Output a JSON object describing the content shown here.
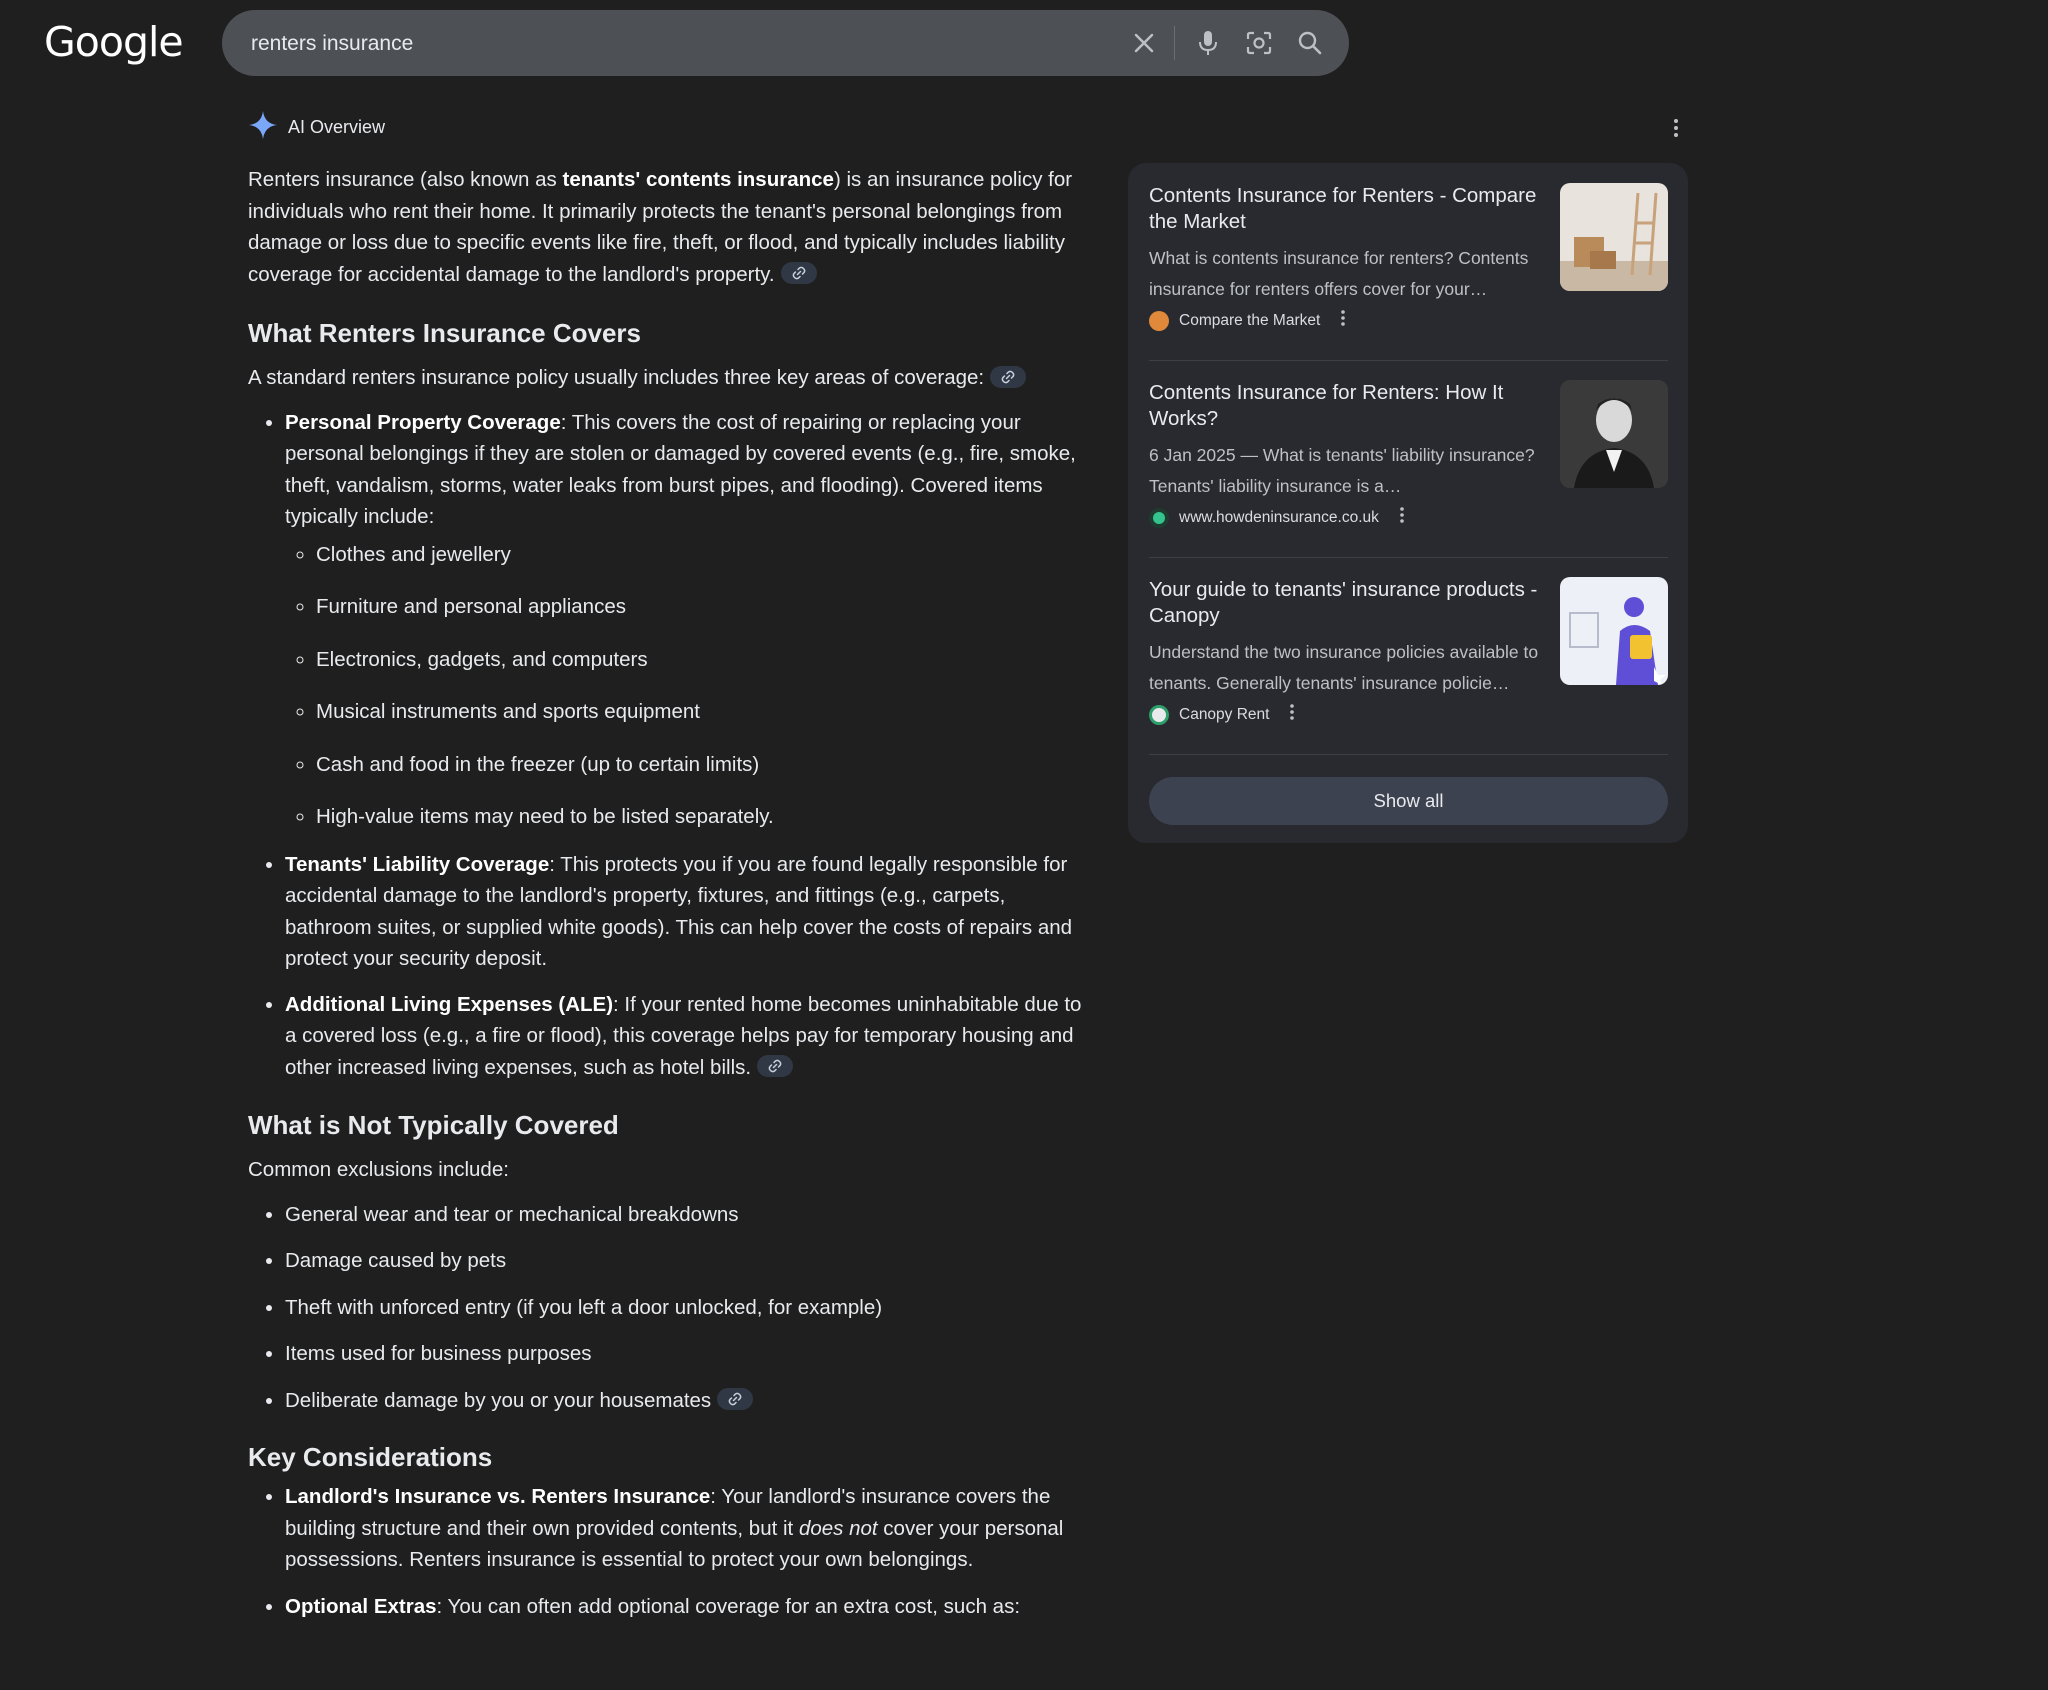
{
  "header": {
    "logo": "Google",
    "search_value": "renters insurance"
  },
  "ai_overview": {
    "label": "AI Overview",
    "intro": {
      "pre": "Renters insurance (also known as ",
      "bold": "tenants' contents insurance",
      "post": ") is an insurance policy for individuals who rent their home. It primarily protects the tenant's personal belongings from damage or loss due to specific events like fire, theft, or flood, and typically includes liability coverage for accidental damage to the landlord's property."
    },
    "covers": {
      "heading": "What Renters Insurance Covers",
      "lead": "A standard renters insurance policy usually includes three key areas of coverage:",
      "items": [
        {
          "bold": "Personal Property Coverage",
          "text": ": This covers the cost of repairing or replacing your personal belongings if they are stolen or damaged by covered events (e.g., fire, smoke, theft, vandalism, storms, water leaks from burst pipes, and flooding). Covered items typically include:"
        },
        {
          "bold": "Tenants' Liability Coverage",
          "text": ": This protects you if you are found legally responsible for accidental damage to the landlord's property, fixtures, and fittings (e.g., carpets, bathroom suites, or supplied white goods). This can help cover the costs of repairs and protect your security deposit."
        },
        {
          "bold": "Additional Living Expenses (ALE)",
          "text": ": If your rented home becomes uninhabitable due to a covered loss (e.g., a fire or flood), this coverage helps pay for temporary housing and other increased living expenses, such as hotel bills."
        }
      ],
      "sub_items": [
        "Clothes and jewellery",
        "Furniture and personal appliances",
        "Electronics, gadgets, and computers",
        "Musical instruments and sports equipment",
        "Cash and food in the freezer (up to certain limits)",
        "High-value items may need to be listed separately."
      ]
    },
    "not_covered": {
      "heading": "What is Not Typically Covered",
      "lead": "Common exclusions include:",
      "items": [
        "General wear and tear or mechanical breakdowns",
        "Damage caused by pets",
        "Theft with unforced entry (if you left a door unlocked, for example)",
        "Items used for business purposes",
        "Deliberate damage by you or your housemates"
      ]
    },
    "considerations": {
      "heading": "Key Considerations",
      "item1": {
        "bold": "Landlord's Insurance vs. Renters Insurance",
        "text1": ": Your landlord's insurance covers the building structure and their own provided contents, but it ",
        "italic": "does not",
        "text2": " cover your personal possessions. Renters insurance is essential to protect your own belongings."
      },
      "item2": {
        "bold": "Optional Extras",
        "text": ": You can often add optional coverage for an extra cost, such as:"
      }
    }
  },
  "sources": {
    "cards": [
      {
        "title": "Contents Insurance for Renters - Compare the Market",
        "snippet": "What is contents insurance for renters? Contents insurance for renters offers cover for your…",
        "source": "Compare the Market",
        "fav_color": "#e0893a"
      },
      {
        "title": "Contents Insurance for Renters: How It Works?",
        "snippet": "6 Jan 2025 — What is tenants' liability insurance? Tenants' liability insurance is a…",
        "source": "www.howdeninsurance.co.uk",
        "fav_color": "#34c38f"
      },
      {
        "title": "Your guide to tenants' insurance products - Canopy",
        "snippet": "Understand the two insurance policies available to tenants. Generally tenants' insurance policie…",
        "source": "Canopy Rent",
        "fav_color": "#2e9e6a"
      }
    ],
    "show_all": "Show all"
  },
  "colors": {
    "background": "#1f1f1f",
    "accent": "#8ab4f8"
  }
}
